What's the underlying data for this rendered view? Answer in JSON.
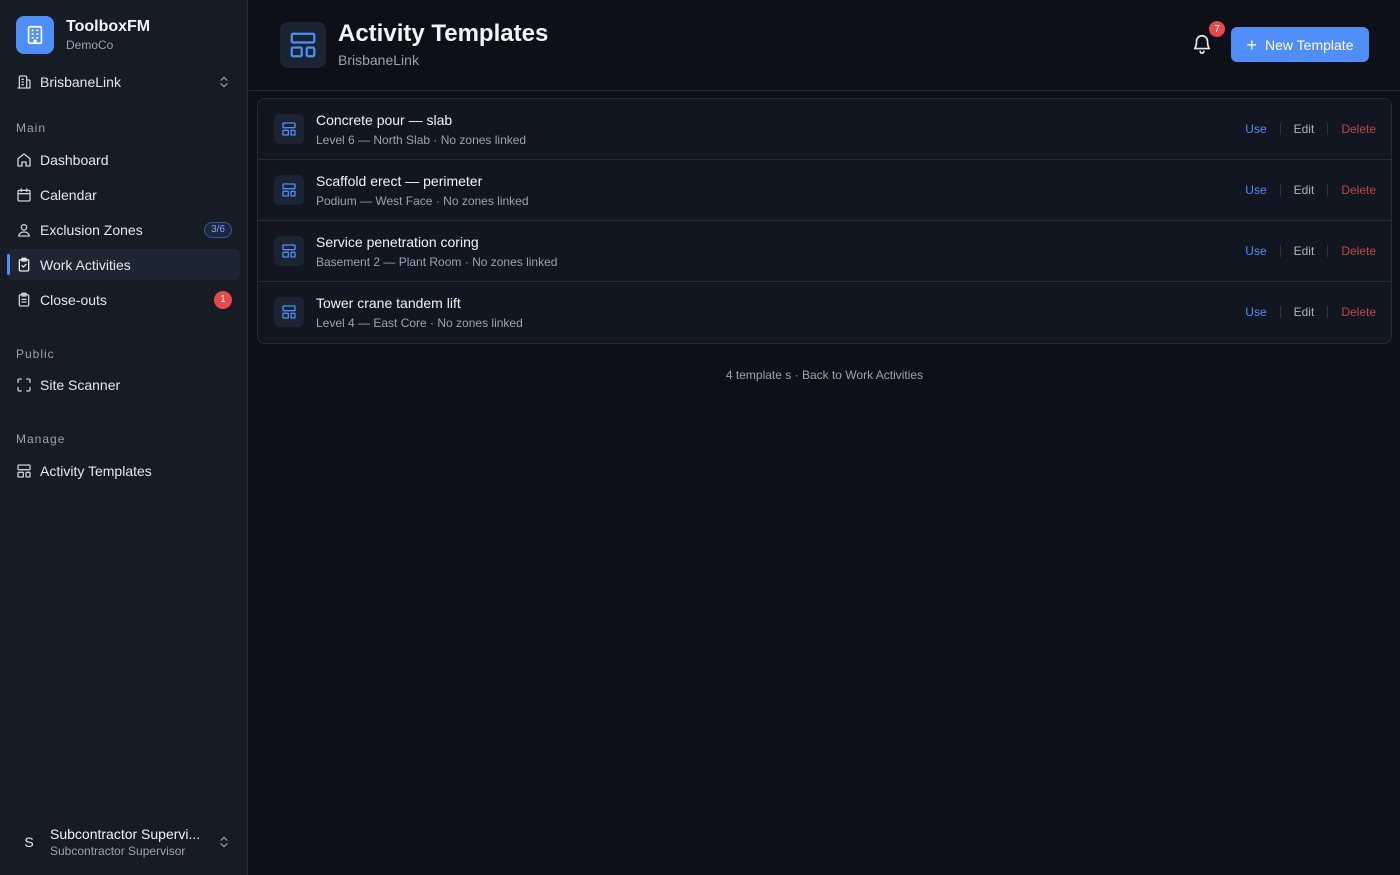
{
  "app": {
    "name": "ToolboxFM",
    "org": "DemoCo"
  },
  "org_switcher": {
    "label": "BrisbaneLink"
  },
  "sidebar": {
    "sections": {
      "main": "Main",
      "public": "Public",
      "manage": "Manage"
    },
    "items": [
      {
        "label": "Dashboard",
        "icon": "home-icon"
      },
      {
        "label": "Calendar",
        "icon": "calendar-icon"
      },
      {
        "label": "Exclusion Zones",
        "icon": "person-pin-icon",
        "badge": "3/6"
      },
      {
        "label": "Work Activities",
        "icon": "clipboard-check-icon",
        "active": true
      },
      {
        "label": "Close-outs",
        "icon": "clipboard-list-icon",
        "badge": "1"
      },
      {
        "label": "Site Scanner",
        "icon": "scan-icon"
      },
      {
        "label": "Activity Templates",
        "icon": "template-icon"
      }
    ]
  },
  "user": {
    "initial": "S",
    "name": "Subcontractor Supervi...",
    "role": "Subcontractor Supervisor"
  },
  "header": {
    "title": "Activity Templates",
    "subtitle": "BrisbaneLink",
    "notifications": "7",
    "new_button": "New Template"
  },
  "templates": [
    {
      "title": "Concrete pour — slab",
      "subtitle": "Level 6 — North Slab · No zones linked"
    },
    {
      "title": "Scaffold erect — perimeter",
      "subtitle": "Podium — West Face · No zones linked"
    },
    {
      "title": "Service penetration coring",
      "subtitle": "Basement 2 — Plant Room · No zones linked"
    },
    {
      "title": "Tower crane tandem lift",
      "subtitle": "Level 4 — East Core · No zones linked"
    }
  ],
  "actions": {
    "use": "Use",
    "edit": "Edit",
    "delete": "Delete"
  },
  "footer": {
    "count": "4 template s",
    "separator": "·",
    "back": "Back to Work Activities"
  },
  "colors": {
    "accent": "#4f8ef7",
    "danger": "#e5484d",
    "background": "#0d1117",
    "sidebar": "#161b24"
  }
}
